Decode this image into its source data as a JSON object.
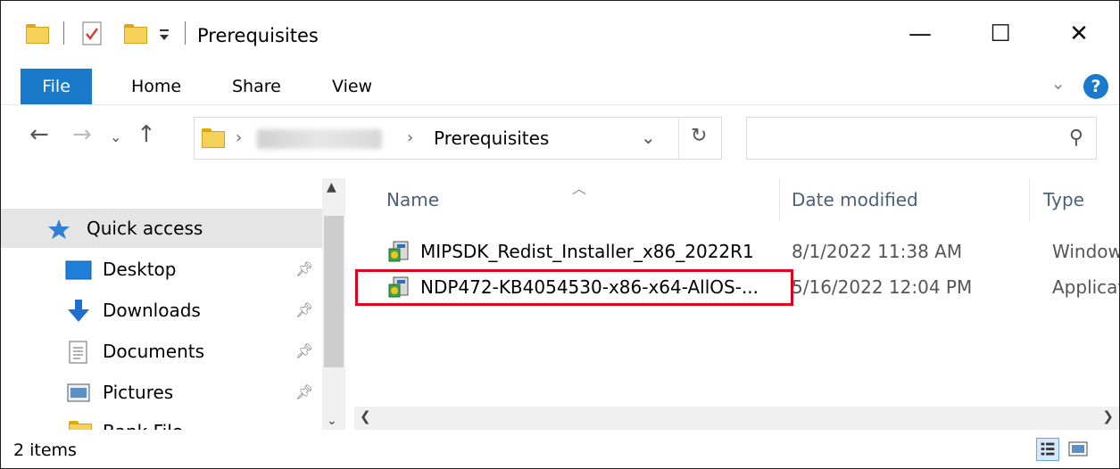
{
  "window": {
    "title": "Prerequisites",
    "controls": {
      "minimize": "—",
      "maximize": "☐",
      "close": "✕"
    }
  },
  "ribbon": {
    "tabs": [
      "File",
      "Home",
      "Share",
      "View"
    ],
    "help": "?"
  },
  "address": {
    "current": "Prerequisites",
    "search_placeholder": ""
  },
  "nav_pane": {
    "items": [
      {
        "label": "Quick access",
        "icon": "star-icon"
      },
      {
        "label": "Desktop",
        "icon": "desktop-icon",
        "pinned": true
      },
      {
        "label": "Downloads",
        "icon": "download-arrow-icon",
        "pinned": true
      },
      {
        "label": "Documents",
        "icon": "documents-icon",
        "pinned": true
      },
      {
        "label": "Pictures",
        "icon": "pictures-icon",
        "pinned": true
      },
      {
        "label": "Bank File",
        "icon": "folder-icon"
      }
    ]
  },
  "file_list": {
    "columns": {
      "name": "Name",
      "date": "Date modified",
      "type": "Type"
    },
    "rows": [
      {
        "name": "MIPSDK_Redist_Installer_x86_2022R1",
        "date": "8/1/2022 11:38 AM",
        "type": "Window"
      },
      {
        "name": "NDP472-KB4054530-x86-x64-AllOS-...",
        "date": "5/16/2022 12:04 PM",
        "type": "Applicat",
        "highlighted": true
      }
    ]
  },
  "status": {
    "count": "2 items"
  },
  "colors": {
    "accent": "#1979ca",
    "highlight_border": "#e0001b"
  }
}
